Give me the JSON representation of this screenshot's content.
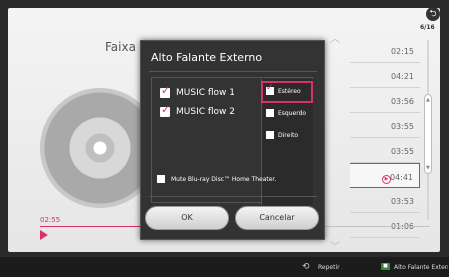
{
  "player": {
    "section_label": "Faixa",
    "elapsed": "02:55",
    "counter": "6/16",
    "back_icon": "back-icon",
    "tracks": [
      "02:15",
      "04:21",
      "03:56",
      "03:55",
      "03:55",
      "04:41",
      "03:53",
      "01:06"
    ],
    "playing_index": 5
  },
  "dialog": {
    "title": "Alto Falante Externo",
    "flows": [
      "MUSIC flow 1",
      "MUSIC flow 2"
    ],
    "channels": {
      "stereo": "Estéreo",
      "left": "Esquerdo",
      "right": "Direito"
    },
    "mute_label": "Mute Blu-ray Disc™ Home Theater.",
    "ok_label": "OK",
    "cancel_label": "Cancelar"
  },
  "bottom_bar": {
    "repeat_label": "Repetir",
    "speaker_label": "Alto Falante Externo"
  },
  "colors": {
    "accent": "#d6336c",
    "green_key": "#2e8b2e"
  }
}
